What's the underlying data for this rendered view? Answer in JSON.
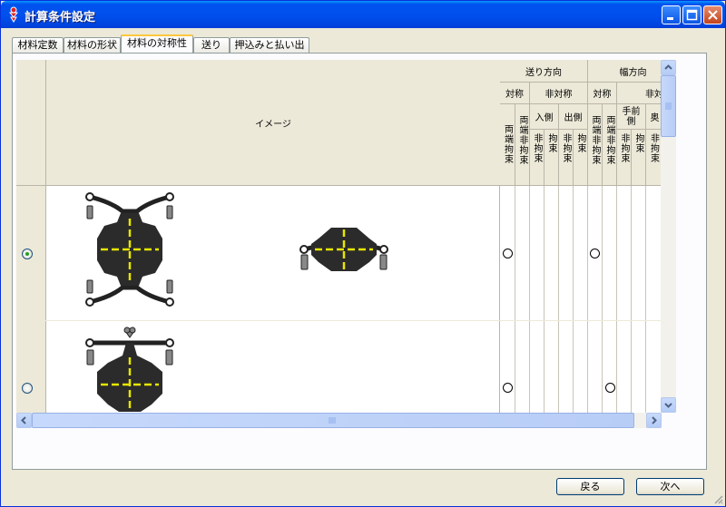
{
  "window": {
    "title": "計算条件設定",
    "colors": {
      "titlebar": "#0054e3",
      "accent": "#ffc83c",
      "selected_radio": "#21a121"
    }
  },
  "tabs": [
    {
      "label": "材料定数",
      "active": false
    },
    {
      "label": "材料の形状",
      "active": false
    },
    {
      "label": "材料の対称性",
      "active": true
    },
    {
      "label": "送り",
      "active": false
    },
    {
      "label": "押込みと払い出し",
      "active": false
    }
  ],
  "table": {
    "image_header": "イメージ",
    "feed_direction": "送り方向",
    "width_direction": "幅方向",
    "symmetric": "対称",
    "asymmetric": "非対称",
    "entry_side": "入側",
    "exit_side": "出側",
    "front_side": "手前側",
    "back_side": "奥",
    "both_ends_fixed": "両端拘束",
    "both_ends_free": "両端非拘束",
    "free": "非拘束",
    "fixed": "拘束",
    "rows": [
      {
        "selected": true
      },
      {
        "selected": false
      }
    ]
  },
  "buttons": {
    "back": "戻る",
    "next": "次へ"
  }
}
